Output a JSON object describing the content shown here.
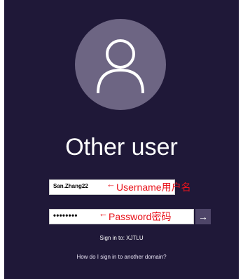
{
  "user": {
    "display_name": "Other user"
  },
  "login": {
    "username_value": "San.Zhang22",
    "username_annotation": "Username用户名",
    "password_dots": "••••••••",
    "password_annotation": "Password密码",
    "arrow_glyph": "←",
    "submit_glyph": "→"
  },
  "footer": {
    "sign_in_to": "Sign in to: XJTLU",
    "other_domain_link": "How do I sign in to another domain?"
  },
  "colors": {
    "background": "#1f1838",
    "avatar": "#6d6583",
    "annotation": "#e8141c",
    "submit_button": "#4e4568"
  },
  "icons": {
    "avatar": "user-silhouette-icon",
    "submit": "arrow-right-icon"
  }
}
